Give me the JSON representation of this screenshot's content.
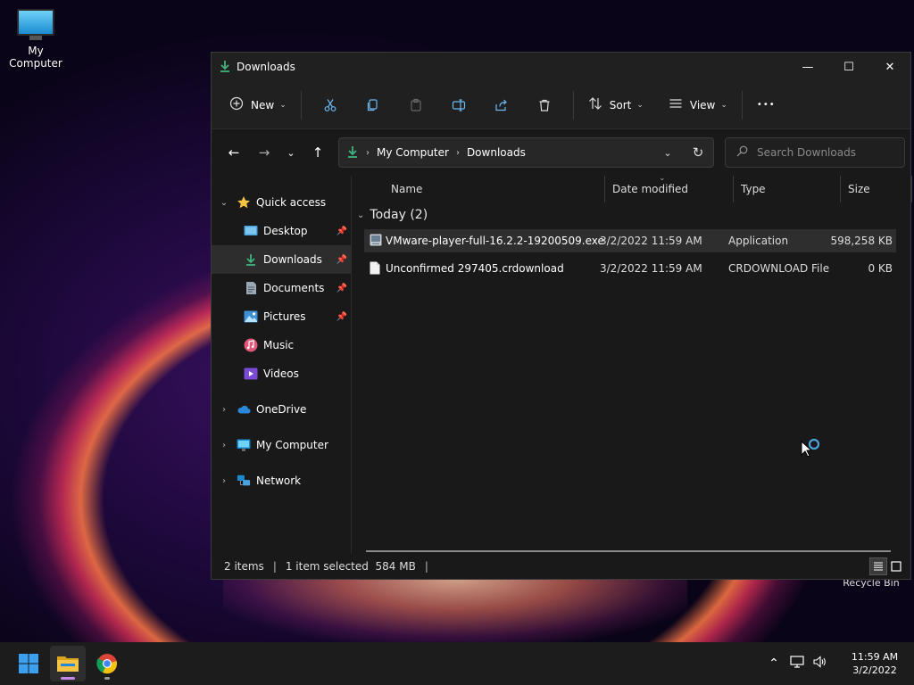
{
  "desktop": {
    "icons": [
      {
        "label": "My Computer"
      }
    ],
    "recycle_label": "Recycle Bin"
  },
  "window": {
    "title": "Downloads",
    "controls": {
      "minimize": "—",
      "maximize": "☐",
      "close": "✕"
    }
  },
  "toolbar": {
    "new_label": "New",
    "sort_label": "Sort",
    "view_label": "View",
    "more_label": "•••"
  },
  "address": {
    "crumbs": [
      "My Computer",
      "Downloads"
    ]
  },
  "search": {
    "placeholder": "Search Downloads"
  },
  "sidebar": {
    "quick_access": "Quick access",
    "items": [
      {
        "label": "Desktop"
      },
      {
        "label": "Downloads"
      },
      {
        "label": "Documents"
      },
      {
        "label": "Pictures"
      },
      {
        "label": "Music"
      },
      {
        "label": "Videos"
      }
    ],
    "onedrive": "OneDrive",
    "my_computer": "My Computer",
    "network": "Network"
  },
  "columns": {
    "name": "Name",
    "date": "Date modified",
    "type": "Type",
    "size": "Size"
  },
  "group": {
    "label": "Today (2)"
  },
  "files": [
    {
      "name": "VMware-player-full-16.2.2-19200509.exe",
      "date": "3/2/2022 11:59 AM",
      "type": "Application",
      "size": "598,258 KB"
    },
    {
      "name": "Unconfirmed 297405.crdownload",
      "date": "3/2/2022 11:59 AM",
      "type": "CRDOWNLOAD File",
      "size": "0 KB"
    }
  ],
  "status": {
    "count": "2 items",
    "selected": "1 item selected  584 MB"
  },
  "taskbar": {
    "time": "11:59 AM",
    "date": "3/2/2022"
  },
  "colors": {
    "accent": "#c48ae8",
    "folder": "#f6c342",
    "download_arrow": "#3fb27f"
  }
}
